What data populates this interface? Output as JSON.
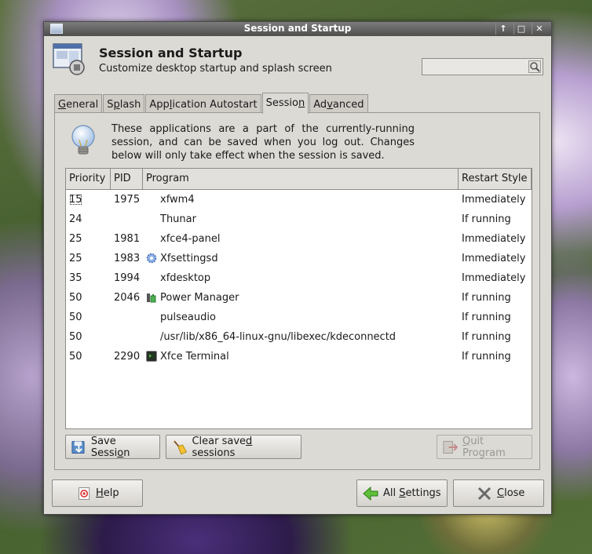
{
  "window": {
    "title": "Session and Startup"
  },
  "header": {
    "title": "Session and Startup",
    "subtitle": "Customize desktop startup and splash screen",
    "search_placeholder": ""
  },
  "tabs": [
    {
      "label_pre": "",
      "label_u": "G",
      "label_post": "eneral"
    },
    {
      "label_pre": "S",
      "label_u": "p",
      "label_post": "lash"
    },
    {
      "label_pre": "App",
      "label_u": "l",
      "label_post": "ication Autostart"
    },
    {
      "label_pre": "Sessio",
      "label_u": "n",
      "label_post": ""
    },
    {
      "label_pre": "Ad",
      "label_u": "v",
      "label_post": "anced"
    }
  ],
  "info": {
    "text": "These applications are a part of the currently-running session, and can be saved when you log out.  Changes below will only take effect when the session is saved."
  },
  "columns": {
    "priority": "Priority",
    "pid": "PID",
    "program": "Program",
    "restart": "Restart Style"
  },
  "rows": [
    {
      "priority": "15",
      "pid": "1975",
      "icon": "",
      "program": "xfwm4",
      "restart": "Immediately"
    },
    {
      "priority": "24",
      "pid": "",
      "icon": "",
      "program": "Thunar",
      "restart": "If running"
    },
    {
      "priority": "25",
      "pid": "1981",
      "icon": "",
      "program": "xfce4-panel",
      "restart": "Immediately"
    },
    {
      "priority": "25",
      "pid": "1983",
      "icon": "gear-icon",
      "program": "Xfsettingsd",
      "restart": "Immediately"
    },
    {
      "priority": "35",
      "pid": "1994",
      "icon": "",
      "program": "xfdesktop",
      "restart": "Immediately"
    },
    {
      "priority": "50",
      "pid": "2046",
      "icon": "power-manager-icon",
      "program": "Power Manager",
      "restart": "If running"
    },
    {
      "priority": "50",
      "pid": "",
      "icon": "",
      "program": "pulseaudio",
      "restart": "If running"
    },
    {
      "priority": "50",
      "pid": "",
      "icon": "",
      "program": "/usr/lib/x86_64-linux-gnu/libexec/kdeconnectd",
      "restart": "If running"
    },
    {
      "priority": "50",
      "pid": "2290",
      "icon": "terminal-icon",
      "program": "Xfce Terminal",
      "restart": "If running"
    }
  ],
  "buttons": {
    "save_pre": "Save Sessi",
    "save_u": "o",
    "save_post": "n",
    "clear_pre": "Clear save",
    "clear_u": "d",
    "clear_post": " sessions",
    "quit_pre": "",
    "quit_u": "Q",
    "quit_post": "uit Program",
    "help_pre": "",
    "help_u": "H",
    "help_post": "elp",
    "all_pre": "All ",
    "all_u": "S",
    "all_post": "ettings",
    "close_pre": "",
    "close_u": "C",
    "close_post": "lose"
  }
}
